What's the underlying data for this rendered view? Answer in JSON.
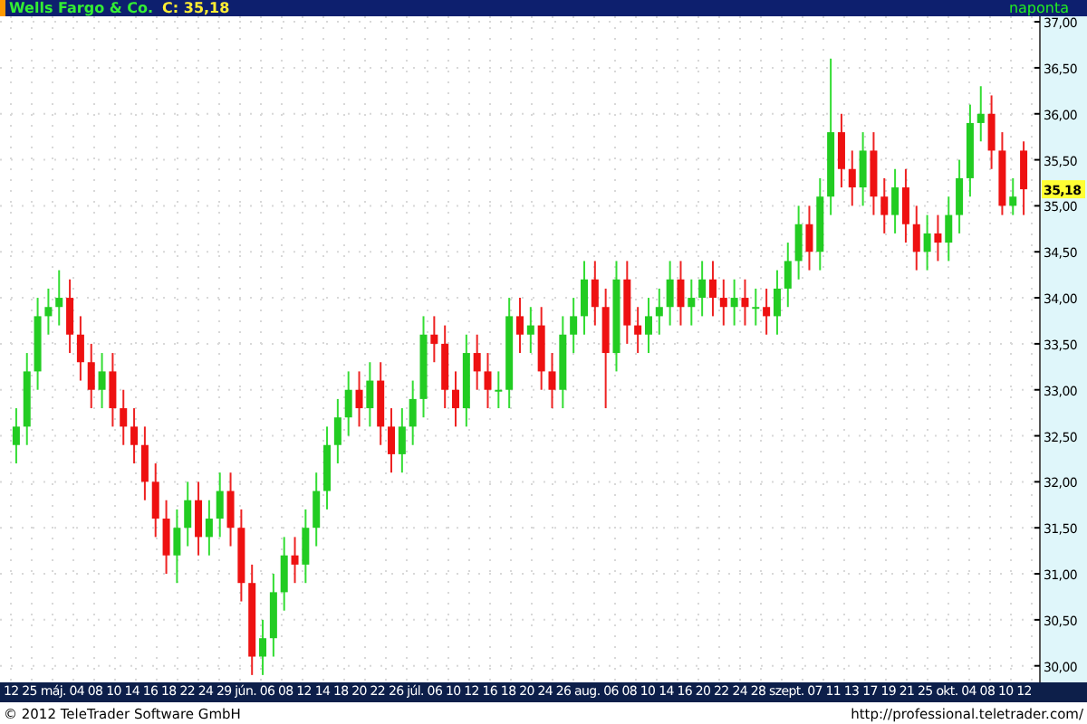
{
  "header": {
    "instrument": "Wells Fargo & Co.",
    "close": "C: 35,18",
    "interval": "naponta"
  },
  "chart": {
    "price_marker": "35,18",
    "chart_data": {
      "type": "candlestick",
      "grid": true,
      "ylim": [
        29.82,
        37.06
      ],
      "yticks": [
        {
          "value": 30,
          "label": "30,00"
        },
        {
          "value": 30.5,
          "label": "30,50"
        },
        {
          "value": 31,
          "label": "31,00"
        },
        {
          "value": 31.5,
          "label": "31,50"
        },
        {
          "value": 32,
          "label": "32,00"
        },
        {
          "value": 32.5,
          "label": "32,50"
        },
        {
          "value": 33,
          "label": "33,00"
        },
        {
          "value": 33.5,
          "label": "33,50"
        },
        {
          "value": 34,
          "label": "34,00"
        },
        {
          "value": 34.5,
          "label": "34,50"
        },
        {
          "value": 35,
          "label": "35,00"
        },
        {
          "value": 35.5,
          "label": "35,50"
        },
        {
          "value": 36,
          "label": "36,00"
        },
        {
          "value": 36.5,
          "label": "36,50"
        },
        {
          "value": 37,
          "label": "37,00"
        }
      ],
      "ohlc": [
        [
          32.4,
          32.8,
          32.2,
          32.6
        ],
        [
          32.6,
          33.4,
          32.4,
          33.2
        ],
        [
          33.2,
          34.0,
          33.0,
          33.8
        ],
        [
          33.8,
          34.1,
          33.6,
          33.9
        ],
        [
          33.9,
          34.3,
          33.7,
          34.0
        ],
        [
          34.0,
          34.2,
          33.4,
          33.6
        ],
        [
          33.6,
          33.8,
          33.1,
          33.3
        ],
        [
          33.3,
          33.5,
          32.8,
          33.0
        ],
        [
          33.0,
          33.4,
          32.8,
          33.2
        ],
        [
          33.2,
          33.4,
          32.6,
          32.8
        ],
        [
          32.8,
          33.0,
          32.4,
          32.6
        ],
        [
          32.6,
          32.8,
          32.2,
          32.4
        ],
        [
          32.4,
          32.6,
          31.8,
          32.0
        ],
        [
          32.0,
          32.2,
          31.4,
          31.6
        ],
        [
          31.6,
          31.8,
          31.0,
          31.2
        ],
        [
          31.2,
          31.7,
          30.9,
          31.5
        ],
        [
          31.5,
          32.0,
          31.3,
          31.8
        ],
        [
          31.8,
          32.0,
          31.2,
          31.4
        ],
        [
          31.4,
          31.8,
          31.2,
          31.6
        ],
        [
          31.6,
          32.1,
          31.4,
          31.9
        ],
        [
          31.9,
          32.1,
          31.3,
          31.5
        ],
        [
          31.5,
          31.7,
          30.7,
          30.9
        ],
        [
          30.9,
          31.1,
          29.9,
          30.1
        ],
        [
          30.1,
          30.5,
          29.9,
          30.3
        ],
        [
          30.3,
          31.0,
          30.1,
          30.8
        ],
        [
          30.8,
          31.4,
          30.6,
          31.2
        ],
        [
          31.2,
          31.4,
          30.9,
          31.1
        ],
        [
          31.1,
          31.7,
          30.9,
          31.5
        ],
        [
          31.5,
          32.1,
          31.3,
          31.9
        ],
        [
          31.9,
          32.6,
          31.7,
          32.4
        ],
        [
          32.4,
          32.9,
          32.2,
          32.7
        ],
        [
          32.7,
          33.2,
          32.5,
          33.0
        ],
        [
          33.0,
          33.2,
          32.6,
          32.8
        ],
        [
          32.8,
          33.3,
          32.6,
          33.1
        ],
        [
          33.1,
          33.3,
          32.4,
          32.6
        ],
        [
          32.6,
          32.8,
          32.1,
          32.3
        ],
        [
          32.3,
          32.8,
          32.1,
          32.6
        ],
        [
          32.6,
          33.1,
          32.4,
          32.9
        ],
        [
          32.9,
          33.8,
          32.7,
          33.6
        ],
        [
          33.6,
          33.8,
          33.3,
          33.5
        ],
        [
          33.5,
          33.7,
          32.8,
          33.0
        ],
        [
          33.0,
          33.2,
          32.6,
          32.8
        ],
        [
          32.8,
          33.6,
          32.6,
          33.4
        ],
        [
          33.4,
          33.6,
          33.0,
          33.2
        ],
        [
          33.2,
          33.4,
          32.8,
          33.0
        ],
        [
          33.0,
          33.2,
          32.8,
          33.0
        ],
        [
          33.0,
          34.0,
          32.8,
          33.8
        ],
        [
          33.8,
          34.0,
          33.4,
          33.6
        ],
        [
          33.6,
          33.9,
          33.4,
          33.7
        ],
        [
          33.7,
          33.9,
          33.0,
          33.2
        ],
        [
          33.2,
          33.4,
          32.8,
          33.0
        ],
        [
          33.0,
          33.8,
          32.8,
          33.6
        ],
        [
          33.6,
          34.0,
          33.4,
          33.8
        ],
        [
          33.8,
          34.4,
          33.6,
          34.2
        ],
        [
          34.2,
          34.4,
          33.7,
          33.9
        ],
        [
          33.9,
          34.1,
          32.8,
          33.4
        ],
        [
          33.4,
          34.4,
          33.2,
          34.2
        ],
        [
          34.2,
          34.4,
          33.5,
          33.7
        ],
        [
          33.7,
          33.9,
          33.4,
          33.6
        ],
        [
          33.6,
          34.0,
          33.4,
          33.8
        ],
        [
          33.8,
          34.1,
          33.6,
          33.9
        ],
        [
          33.9,
          34.4,
          33.7,
          34.2
        ],
        [
          34.2,
          34.4,
          33.7,
          33.9
        ],
        [
          33.9,
          34.2,
          33.7,
          34.0
        ],
        [
          34.0,
          34.4,
          33.8,
          34.2
        ],
        [
          34.2,
          34.4,
          33.8,
          34.0
        ],
        [
          34.0,
          34.2,
          33.7,
          33.9
        ],
        [
          33.9,
          34.2,
          33.7,
          34.0
        ],
        [
          34.0,
          34.2,
          33.7,
          33.9
        ],
        [
          33.9,
          34.1,
          33.7,
          33.9
        ],
        [
          33.9,
          34.1,
          33.6,
          33.8
        ],
        [
          33.8,
          34.3,
          33.6,
          34.1
        ],
        [
          34.1,
          34.6,
          33.9,
          34.4
        ],
        [
          34.4,
          35.0,
          34.2,
          34.8
        ],
        [
          34.8,
          35.0,
          34.3,
          34.5
        ],
        [
          34.5,
          35.3,
          34.3,
          35.1
        ],
        [
          35.1,
          36.6,
          34.9,
          35.8
        ],
        [
          35.8,
          36.0,
          35.2,
          35.4
        ],
        [
          35.4,
          35.6,
          35.0,
          35.2
        ],
        [
          35.2,
          35.8,
          35.0,
          35.6
        ],
        [
          35.6,
          35.8,
          34.9,
          35.1
        ],
        [
          35.1,
          35.3,
          34.7,
          34.9
        ],
        [
          34.9,
          35.4,
          34.7,
          35.2
        ],
        [
          35.2,
          35.4,
          34.6,
          34.8
        ],
        [
          34.8,
          35.0,
          34.3,
          34.5
        ],
        [
          34.5,
          34.9,
          34.3,
          34.7
        ],
        [
          34.7,
          34.9,
          34.4,
          34.6
        ],
        [
          34.6,
          35.1,
          34.4,
          34.9
        ],
        [
          34.9,
          35.5,
          34.7,
          35.3
        ],
        [
          35.3,
          36.1,
          35.1,
          35.9
        ],
        [
          35.9,
          36.3,
          35.7,
          36.0
        ],
        [
          36.0,
          36.2,
          35.4,
          35.6
        ],
        [
          35.6,
          35.8,
          34.9,
          35.0
        ],
        [
          35.0,
          35.3,
          34.9,
          35.1
        ],
        [
          35.6,
          35.7,
          34.9,
          35.18
        ]
      ]
    }
  },
  "date_axis": [
    "12",
    "25",
    "máj.",
    "04",
    "08",
    "10",
    "14",
    "16",
    "18",
    "22",
    "24",
    "29",
    "jún.",
    "06",
    "08",
    "12",
    "14",
    "18",
    "20",
    "22",
    "26",
    "júl.",
    "06",
    "10",
    "12",
    "16",
    "18",
    "20",
    "24",
    "26",
    "aug.",
    "06",
    "08",
    "10",
    "14",
    "16",
    "20",
    "22",
    "24",
    "28",
    "szept.",
    "07",
    "11",
    "13",
    "17",
    "19",
    "21",
    "25",
    "okt.",
    "04",
    "08",
    "10",
    "12"
  ],
  "footer": {
    "copyright": "© 2012 TeleTrader Software GmbH",
    "url": "http://professional.teletrader.com/"
  }
}
